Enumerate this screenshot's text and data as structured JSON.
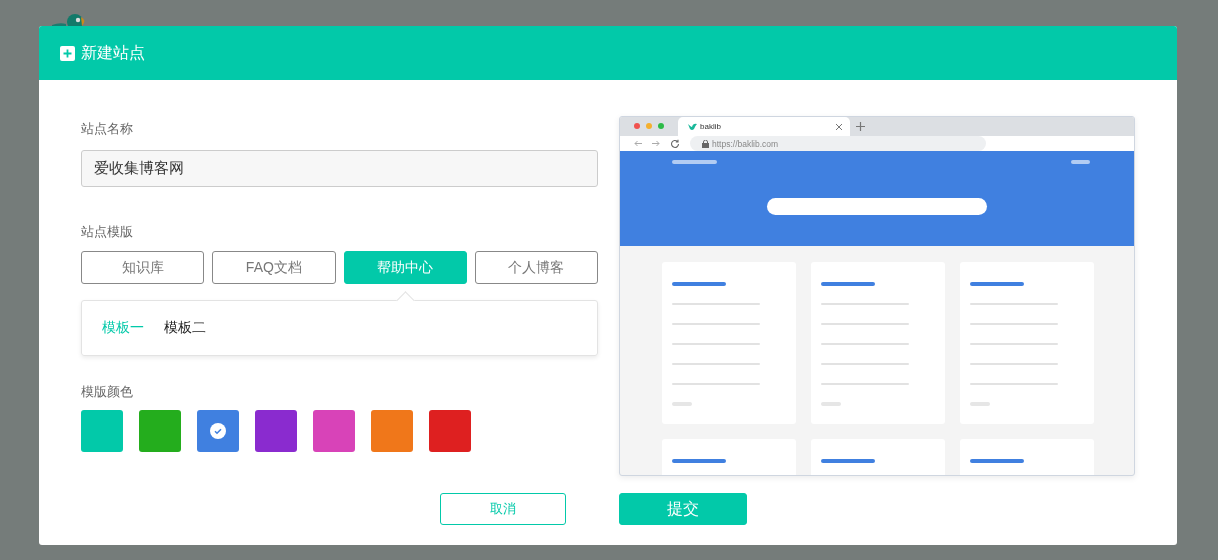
{
  "dialog": {
    "title": "新建站点"
  },
  "site_name": {
    "label": "站点名称",
    "value": "爱收集博客网"
  },
  "template": {
    "label": "站点模版",
    "options": [
      {
        "label": "知识库",
        "selected": false
      },
      {
        "label": "FAQ文档",
        "selected": false
      },
      {
        "label": "帮助中心",
        "selected": true
      },
      {
        "label": "个人博客",
        "selected": false
      }
    ],
    "variants": [
      {
        "label": "模板一",
        "selected": true
      },
      {
        "label": "模板二",
        "selected": false
      }
    ]
  },
  "color": {
    "label": "模版颜色",
    "swatches": [
      {
        "color": "#02c9a9",
        "selected": false
      },
      {
        "color": "#24ad1d",
        "selected": false
      },
      {
        "color": "#4080e0",
        "selected": true
      },
      {
        "color": "#8a2bcf",
        "selected": false
      },
      {
        "color": "#d843b8",
        "selected": false
      },
      {
        "color": "#f0771a",
        "selected": false
      },
      {
        "color": "#de2020",
        "selected": false
      }
    ]
  },
  "preview": {
    "tab_title": "baklib",
    "url": "https://baklib.com"
  },
  "buttons": [
    {
      "label": "取消",
      "kind": "secondary"
    },
    {
      "label": "提交",
      "kind": "primary"
    }
  ]
}
